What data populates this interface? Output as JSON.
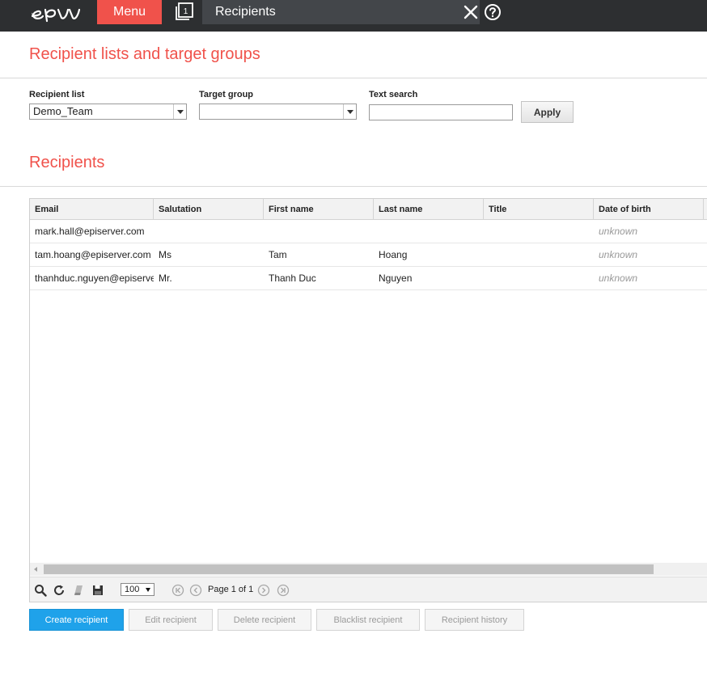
{
  "topbar": {
    "menu_label": "Menu",
    "title": "Recipients",
    "colors": {
      "background": "#2d2f31",
      "menu_accent": "#f0524b"
    }
  },
  "section_lists": {
    "title": "Recipient lists and target groups"
  },
  "filters": {
    "recipient_list_label": "Recipient list",
    "recipient_list_value": "Demo_Team",
    "target_group_label": "Target group",
    "target_group_value": "",
    "text_search_label": "Text search",
    "text_search_value": "",
    "apply_label": "Apply"
  },
  "section_recipients": {
    "title": "Recipients"
  },
  "grid": {
    "columns": [
      "Email",
      "Salutation",
      "First name",
      "Last name",
      "Title",
      "Date of birth"
    ],
    "rows": [
      {
        "email": "mark.hall@episerver.com",
        "salutation": "",
        "first_name": "",
        "last_name": "",
        "title": "",
        "dob": "unknown"
      },
      {
        "email": "tam.hoang@episerver.com",
        "salutation": "Ms",
        "first_name": "Tam",
        "last_name": "Hoang",
        "title": "",
        "dob": "unknown"
      },
      {
        "email": "thanhduc.nguyen@episerver.com",
        "salutation": "Mr.",
        "first_name": "Thanh Duc",
        "last_name": "Nguyen",
        "title": "",
        "dob": "unknown"
      }
    ]
  },
  "pager": {
    "page_size": "100",
    "page_text": "Page 1 of 1",
    "icons": [
      "search-icon",
      "refresh-icon",
      "eraser-icon",
      "save-icon",
      "first-page-icon",
      "prev-page-icon",
      "next-page-icon",
      "last-page-icon"
    ]
  },
  "actions": {
    "create": "Create recipient",
    "edit": "Edit recipient",
    "delete": "Delete recipient",
    "blacklist": "Blacklist recipient",
    "history": "Recipient history"
  }
}
